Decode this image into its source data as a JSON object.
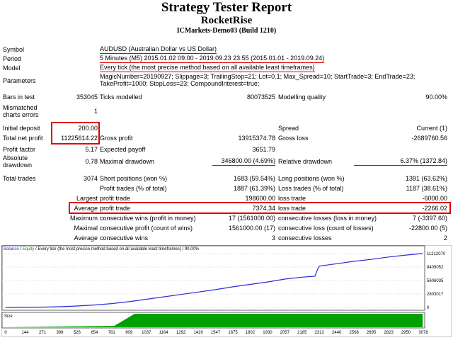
{
  "header": {
    "title": "Strategy Tester Report",
    "ea_name": "RocketRise",
    "server": "ICMarkets-Demo03 (Build 1210)"
  },
  "info": {
    "symbol_label": "Symbol",
    "symbol_value": "AUDUSD (Australian Dollar vs US Dollar)",
    "period_label": "Period",
    "period_value": "5 Minutes (M5) 2015.01.02 09:00 - 2019.09.23 23:55 (2015.01.01 - 2019.09.24)",
    "model_label": "Model",
    "model_value": "Every tick (the most precise method based on all available least timeframes)",
    "parameters_label": "Parameters",
    "parameters_line1": "MagicNumber=20190927; Slippage=3; TrailingStop=21; Lot=0.1; Max_Spread=10; StartTrade=3; EndTrade=23;",
    "parameters_line2": "TakeProfit=1000; StopLoss=23; CompoundInterest=true;"
  },
  "stats": {
    "bars_label": "Bars in test",
    "bars_value": "353045",
    "ticks_label": "Ticks modelled",
    "ticks_value": "80073525",
    "quality_label": "Modelling quality",
    "quality_value": "90.00%",
    "mismatch_label_1": "Mismatched",
    "mismatch_label_2": "charts errors",
    "mismatch_value": "1",
    "initial_deposit_label": "Initial deposit",
    "initial_deposit_value": "200.00",
    "spread_label": "Spread",
    "spread_value": "Current (1)",
    "net_profit_label": "Total net profit",
    "net_profit_value": "11225614.22",
    "gross_profit_label": "Gross profit",
    "gross_profit_value": "13915374.78",
    "gross_loss_label": "Gross loss",
    "gross_loss_value": "-2689760.56",
    "profit_factor_label": "Profit factor",
    "profit_factor_value": "5.17",
    "expected_payoff_label": "Expected payoff",
    "expected_payoff_value": "3651.79",
    "abs_dd_label_1": "Absolute",
    "abs_dd_label_2": "drawdown",
    "abs_dd_value": "0.78",
    "max_dd_label": "Maximal drawdown",
    "max_dd_value": "346800.00 (4.69%)",
    "rel_dd_label": "Relative drawdown",
    "rel_dd_value": "6.37% (1372.84)",
    "total_trades_label": "Total trades",
    "total_trades_value": "3074",
    "short_label": "Short positions (won %)",
    "short_value": "1683 (59.54%)",
    "long_label": "Long positions (won %)",
    "long_value": "1391 (63.62%)",
    "profit_trades_label": "Profit trades (% of total)",
    "profit_trades_value": "1887 (61.39%)",
    "loss_trades_label": "Loss trades (% of total)",
    "loss_trades_value": "1187 (38.61%)",
    "largest_label": "Largest",
    "largest_profit_label": "profit trade",
    "largest_profit_value": "198600.00",
    "largest_loss_label": "loss trade",
    "largest_loss_value": "-6000.00",
    "average_label": "Average",
    "average_profit_label": "profit trade",
    "average_profit_value": "7374.34",
    "average_loss_label": "loss trade",
    "average_loss_value": "-2266.02",
    "maximum_label": "Maximum",
    "max_cons_wins_label": "consecutive wins (profit in money)",
    "max_cons_wins_value": "17 (1561000.00)",
    "max_cons_losses_label": "consecutive losses (loss in money)",
    "max_cons_losses_value": "7 (-3397.60)",
    "maximal_label": "Maximal",
    "maximal_cons_profit_label": "consecutive profit (count of wins)",
    "maximal_cons_profit_value": "1561000.00 (17)",
    "maximal_cons_loss_label": "consecutive loss (count of losses)",
    "maximal_cons_loss_value": "-22800.00 (5)",
    "avg2_label": "Average",
    "avg_cons_wins_label": "consecutive wins",
    "avg_cons_wins_value": "3",
    "avg_cons_losses_label": "consecutive losses",
    "avg_cons_losses_value": "2"
  },
  "chart_data": {
    "type": "line",
    "legend_balance": "Balance",
    "legend_sep": " / ",
    "legend_equity": "Equity",
    "legend_rest": " / Every tick (the most precise method based on all available least timeframes) / 90.00%",
    "size_label": "Size",
    "balance_color": "#2b2bd6",
    "size_color": "#00a000",
    "yticks": [
      "11212070",
      "8409052",
      "5606035",
      "2803017",
      "0"
    ],
    "ylim": [
      0,
      11212070
    ],
    "xticks": [
      "0",
      "144",
      "271",
      "399",
      "526",
      "654",
      "781",
      "909",
      "1037",
      "1164",
      "1292",
      "1420",
      "1547",
      "1675",
      "1802",
      "1930",
      "2057",
      "2185",
      "2312",
      "2440",
      "2568",
      "2695",
      "2823",
      "2950",
      "3078"
    ],
    "xlim": [
      0,
      3078
    ],
    "series": [
      {
        "x": [
          0,
          144,
          271,
          399,
          526,
          654,
          781,
          909,
          1037,
          1164,
          1292,
          1420,
          1547,
          1675,
          1802,
          1930,
          2057,
          2185,
          2280,
          2300,
          2312,
          2440,
          2568,
          2695,
          2823,
          2950,
          3074
        ],
        "values": [
          200,
          20000,
          60000,
          150000,
          300000,
          500000,
          800000,
          1200000,
          1700000,
          2200000,
          2700000,
          3200000,
          3700000,
          4300000,
          4800000,
          5300000,
          5900000,
          6300000,
          6500000,
          8000000,
          8600000,
          9100000,
          9600000,
          10000000,
          10500000,
          10900000,
          11225814
        ]
      }
    ],
    "size_series": {
      "x": [
        0,
        800,
        950,
        3074
      ],
      "values": [
        0,
        0.1,
        1,
        1
      ]
    }
  }
}
